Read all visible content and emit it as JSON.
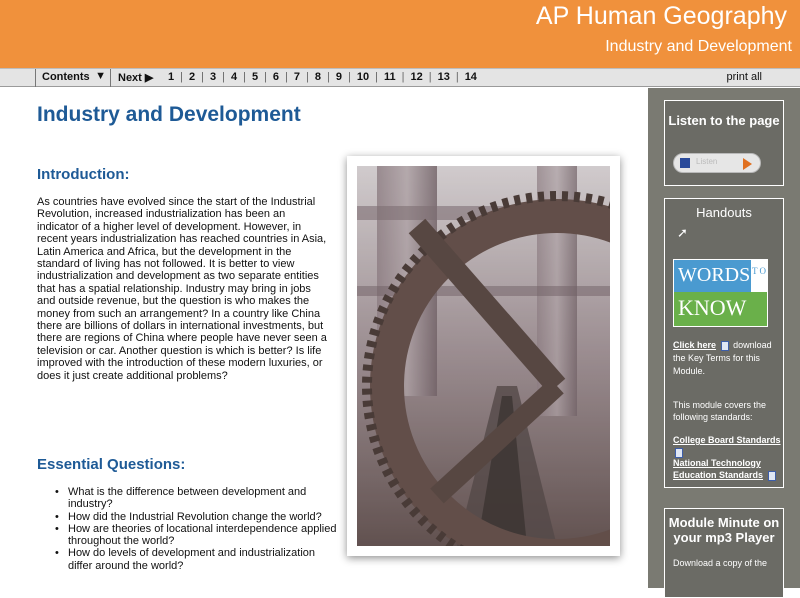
{
  "header": {
    "course_title": "AP Human Geography",
    "module_title": "Industry and Development"
  },
  "navbar": {
    "contents_label": "Contents",
    "contents_caret": "▼",
    "next_label": "Next ▶",
    "pages": [
      "1",
      "2",
      "3",
      "4",
      "5",
      "6",
      "7",
      "8",
      "9",
      "10",
      "11",
      "12",
      "13",
      "14"
    ],
    "print_label": "print all"
  },
  "main": {
    "title": "Industry and Development",
    "intro_heading": "Introduction:",
    "intro_text": "As countries have evolved since the start of the Industrial Revolution, increased industrialization has been an indicator of a higher level of development. However, in recent years industrialization has reached countries in Asia, Latin America and Africa, but the development in the standard of living has not followed. It is better to view industrialization and development as two separate entities that has a spatial relationship. Industry may bring in jobs and outside revenue, but the question is who makes the money from such an arrangement? In a country like China there are billions of dollars in international investments, but there are regions of China where people have never seen a television or car. Another question is which is better? Is life improved with the introduction of these modern luxuries, or does it just create additional problems?",
    "eq_heading": "Essential Questions:",
    "eq_items": [
      "What is the difference between development and industry?",
      "How did the Industrial Revolution change the world?",
      "How are theories of locational interdependence applied throughout the world?",
      "How do levels of development and industrialization differ around the world?"
    ]
  },
  "sidebar": {
    "listen": {
      "title": "Listen to the page",
      "player_label": "Listen"
    },
    "handouts": {
      "title": "Handouts",
      "words_top": "WORDS",
      "words_to": "T O",
      "words_bottom": "KNOW",
      "click_here": "Click here",
      "download_text": "download the Key Terms for this Module.",
      "covers_text": "This module covers the following standards:",
      "std1": "College Board Standards",
      "std2": "National Technology Education Standards"
    },
    "module_minute": {
      "title": "Module Minute on your mp3 Player",
      "desc": "Download a copy of the"
    }
  },
  "colors": {
    "header_orange": "#f0913c",
    "title_blue": "#1e5a96",
    "sidebar_gray": "#7a7a72"
  }
}
